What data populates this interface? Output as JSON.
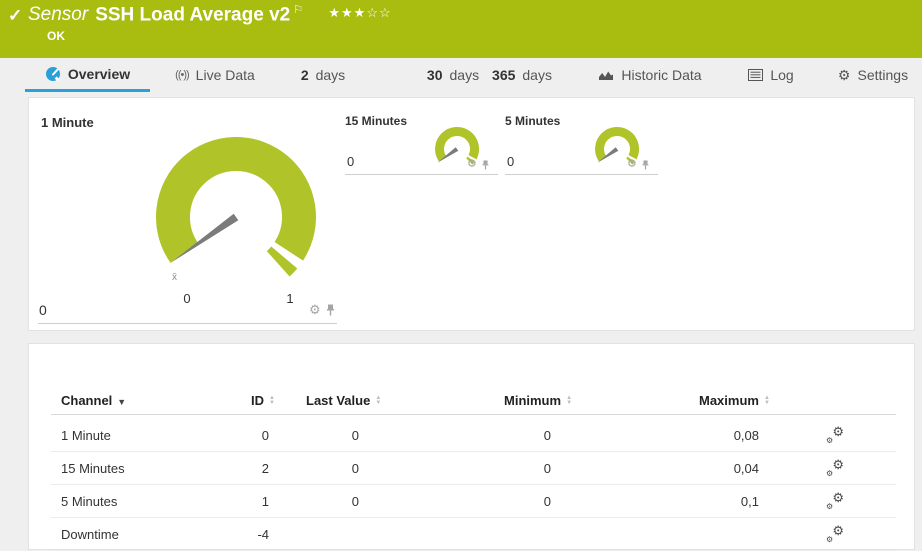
{
  "colors": {
    "brand_green": "#a8bd10",
    "gauge_green": "#b0c42a",
    "accent_blue": "#2b9fd8"
  },
  "titlebar": {
    "check_icon": "✓",
    "kind": "Sensor",
    "title": "SSH Load Average v2",
    "flag_icon": "⚐",
    "stars_filled": "★★★",
    "stars_empty": "☆☆",
    "status": "OK"
  },
  "tabs": {
    "overview": {
      "label": "Overview"
    },
    "live_data": {
      "label": "Live Data",
      "icon": "((•))"
    },
    "days2": {
      "num": "2",
      "unit": "days"
    },
    "days30": {
      "num": "30",
      "unit": "days"
    },
    "days365": {
      "num": "365",
      "unit": "days"
    },
    "historic": {
      "label": "Historic Data"
    },
    "log": {
      "label": "Log"
    },
    "settings": {
      "label": "Settings",
      "icon": "⚙"
    }
  },
  "gauges": {
    "primary": {
      "title": "1 Minute",
      "value": "0",
      "scale_min": "0",
      "scale_max": "1",
      "avg_marker": "x̄"
    },
    "secondary": [
      {
        "title": "15 Minutes",
        "value": "0"
      },
      {
        "title": "5 Minutes",
        "value": "0"
      }
    ]
  },
  "icons": {
    "gear": "⚙",
    "sort_up": "▲",
    "sort_down": "▼",
    "sort_active": "▼"
  },
  "channel_table": {
    "columns": {
      "channel": "Channel",
      "id": "ID",
      "last_value": "Last Value",
      "minimum": "Minimum",
      "maximum": "Maximum"
    },
    "rows": [
      {
        "channel": "1 Minute",
        "id": "0",
        "last_value": "0",
        "minimum": "0",
        "maximum": "0,08"
      },
      {
        "channel": "15 Minutes",
        "id": "2",
        "last_value": "0",
        "minimum": "0",
        "maximum": "0,04"
      },
      {
        "channel": "5 Minutes",
        "id": "1",
        "last_value": "0",
        "minimum": "0",
        "maximum": "0,1"
      },
      {
        "channel": "Downtime",
        "id": "-4",
        "last_value": "",
        "minimum": "",
        "maximum": ""
      }
    ]
  }
}
